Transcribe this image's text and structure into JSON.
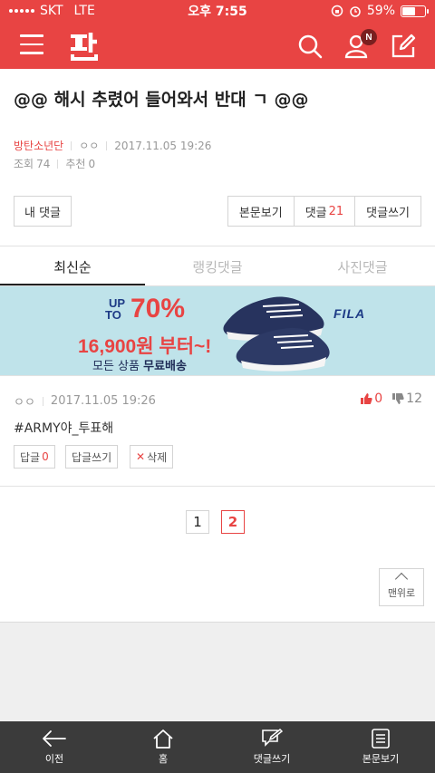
{
  "status": {
    "carrier": "SKT",
    "network": "LTE",
    "time": "오후 7:55",
    "battery": "59%",
    "battery_level": 0.59
  },
  "header": {
    "logo_text": "판",
    "notification_badge": "N"
  },
  "post": {
    "title": "@@ 해시 추렸어 들어와서 반대 ㄱ @@",
    "category": "방탄소년단",
    "author": "ㅇㅇ",
    "datetime": "2017.11.05 19:26",
    "views_label": "조회",
    "views": "74",
    "recommend_label": "추천",
    "recommend": "0"
  },
  "actions": {
    "my_comments": "내 댓글",
    "view_post": "본문보기",
    "comments_label": "댓글",
    "comments_count": "21",
    "write_comment": "댓글쓰기"
  },
  "tabs": [
    {
      "label": "최신순",
      "active": true
    },
    {
      "label": "랭킹댓글",
      "active": false
    },
    {
      "label": "사진댓글",
      "active": false
    }
  ],
  "banner": {
    "up_line1": "UP",
    "up_line2": "TO",
    "percent": "70%",
    "price": "16,900원 부터~!",
    "shipping_prefix": "모든 상품",
    "shipping_bold": "무료배송",
    "brand": "FILA"
  },
  "comment": {
    "author": "ㅇㅇ",
    "datetime": "2017.11.05 19:26",
    "up": "0",
    "down": "12",
    "text": "#ARMY야_투표해",
    "reply_label": "답글",
    "reply_count": "0",
    "write_reply": "답글쓰기",
    "delete": "삭제"
  },
  "pagination": {
    "pages": [
      "1",
      "2"
    ],
    "current": "2"
  },
  "to_top": "맨위로",
  "bottom_nav": [
    {
      "label": "이전",
      "icon": "back-arrow-icon"
    },
    {
      "label": "홈",
      "icon": "home-icon"
    },
    {
      "label": "댓글쓰기",
      "icon": "write-comment-icon"
    },
    {
      "label": "본문보기",
      "icon": "document-icon"
    }
  ],
  "colors": {
    "accent": "#e84443",
    "banner_bg": "#bfe3ea",
    "bottom_bar": "#3b3b3b"
  }
}
